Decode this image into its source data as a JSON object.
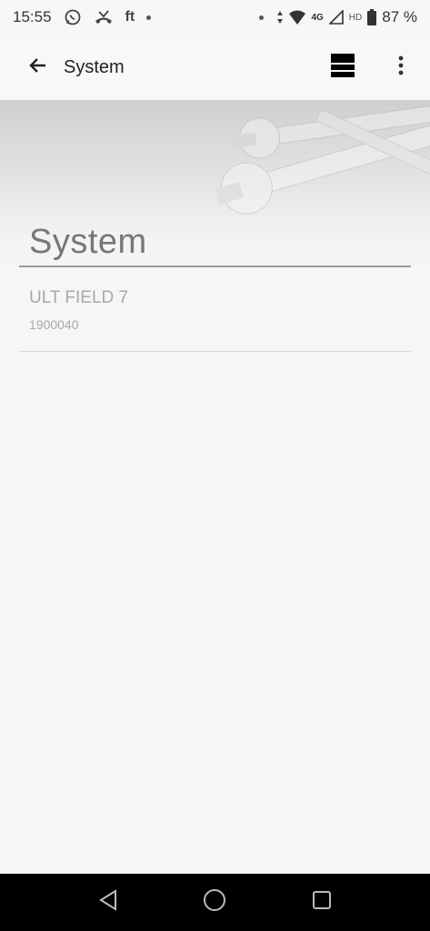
{
  "status_bar": {
    "time": "15:55",
    "icons_left": [
      "whatsapp-icon",
      "missed-call-icon",
      "ft-app-icon",
      "notification-dot"
    ],
    "ft_label": "ft",
    "network_label": "4G",
    "hd_label": "HD",
    "battery_percent": "87 %"
  },
  "app_bar": {
    "title": "System",
    "back_icon": "arrow-left-icon",
    "view_icon": "list-view-icon",
    "more_icon": "more-vert-icon"
  },
  "section": {
    "title": "System"
  },
  "items": [
    {
      "name": "ULT FIELD 7",
      "serial": "1900040"
    }
  ],
  "nav_bar": {
    "back_icon": "nav-back-icon",
    "home_icon": "nav-home-icon",
    "recents_icon": "nav-recents-icon"
  },
  "colors": {
    "accent_text": "#777777",
    "muted_text": "#a8a8a8",
    "nav_background": "#000000"
  }
}
